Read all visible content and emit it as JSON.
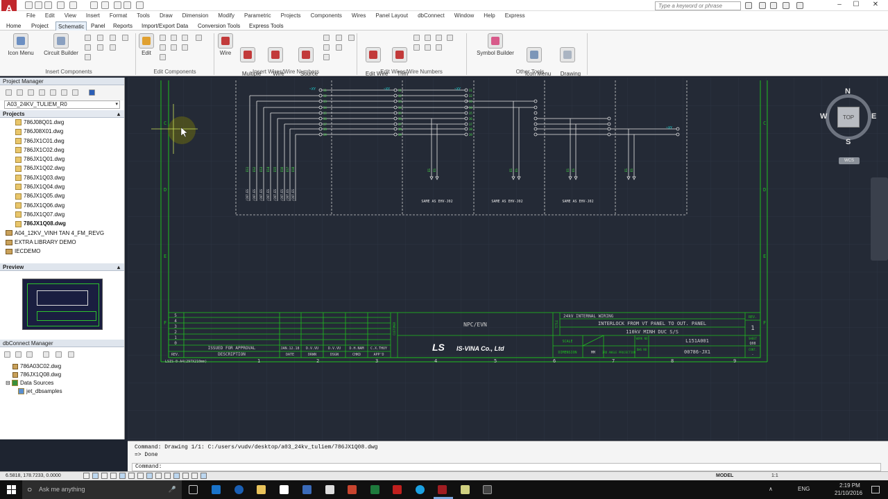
{
  "window": {
    "search_placeholder": "Type a keyword or phrase",
    "min": "–",
    "max": "☐",
    "close": "✕"
  },
  "menubar": [
    "File",
    "Edit",
    "View",
    "Insert",
    "Format",
    "Tools",
    "Draw",
    "Dimension",
    "Modify",
    "Parametric",
    "Projects",
    "Components",
    "Wires",
    "Panel Layout",
    "dbConnect",
    "Window",
    "Help",
    "Express"
  ],
  "tabs": [
    "Home",
    "Project",
    "Schematic",
    "Panel",
    "Reports",
    "Import/Export Data",
    "Conversion Tools",
    "Express Tools"
  ],
  "active_tab": "Schematic",
  "ribbon": {
    "insert_components": {
      "label": "Insert Components",
      "buttons": [
        "Icon Menu",
        "Circuit Builder"
      ]
    },
    "edit_components": {
      "label": "Edit Components",
      "buttons": [
        "Edit"
      ]
    },
    "insert_wires": {
      "label": "Insert Wires/Wire Numbers",
      "buttons": [
        "Wire",
        "Multiple\nBus",
        "Wire\nNumbers",
        "Source\nArrow"
      ]
    },
    "edit_wires": {
      "label": "Edit Wires/Wire Numbers",
      "buttons": [
        "Edit Wire\nNumber",
        "Trim\nWire"
      ]
    },
    "other_tools": {
      "label": "Other Tools",
      "buttons": [
        "Symbol Builder",
        "Icon Menu\nWizard",
        "Drawing\nProperties"
      ]
    }
  },
  "project_manager": {
    "title": "Project Manager",
    "current_project": "A03_24KV_TULIEM_R0",
    "projects_label": "Projects",
    "files": [
      "786J08Q01.dwg",
      "786J08X01.dwg",
      "786JX1C01.dwg",
      "786JX1C02.dwg",
      "786JX1Q01.dwg",
      "786JX1Q02.dwg",
      "786JX1Q03.dwg",
      "786JX1Q04.dwg",
      "786JX1Q05.dwg",
      "786JX1Q06.dwg",
      "786JX1Q07.dwg",
      "786JX1Q08.dwg"
    ],
    "active_file": "786JX1Q08.dwg",
    "other_projects": [
      "A04_12KV_VINH TAN 4_FM_REVG",
      "EXTRA LIBRARY DEMO",
      "IECDEMO"
    ],
    "preview_label": "Preview"
  },
  "dbconnect": {
    "title": "dbConnect Manager",
    "items": [
      "786A03C02.dwg",
      "786JX1Q08.dwg"
    ],
    "data_sources": "Data Sources",
    "source": "jet_dbsamples"
  },
  "drawing": {
    "row_labels": [
      "C",
      "D",
      "E",
      "F"
    ],
    "col_numbers": [
      "1",
      "2",
      "3",
      "4",
      "5",
      "6",
      "7",
      "8",
      "9"
    ],
    "same_as": [
      "SAME AS EHV-J02",
      "SAME AS EHV-J02",
      "SAME AS EHV-J02"
    ],
    "bus_label": "~XY",
    "title_block": {
      "customer": "NPC/EVN",
      "customer_tag": "CUSTOMER",
      "title_tag": "TITLE",
      "title1": "24kV INTERNAL WIRING",
      "title2": "INTERLOCK FROM VT PANEL TO OUT. PANEL",
      "title3": "110kV MINH DUC S/S",
      "rev_tag": "REV.",
      "rev_val": "1",
      "scale_tag": "SCALE",
      "work_no_tag": "WORK NO",
      "work_no": "L151A001",
      "sheet_tag": "SHEET",
      "sheet": "Q08",
      "dimension_tag": "DIMENSION",
      "unit": "MM",
      "projection": "3RD ANGLE PROJECTION",
      "dwg_no_tag": "DWG NO",
      "dwg_no": "00786-JX1",
      "cont_tag": "CONT.",
      "cont": "-",
      "company_logo": "LS",
      "company": "IS-VINA Co., Ltd",
      "rev_rows": [
        "5",
        "4",
        "3",
        "2",
        "1",
        "0"
      ],
      "issued": "ISSUED FOR APPROVAL",
      "issue_date": "JAN.12.18",
      "drawn": "D.V.VU",
      "designed": "D.V.VU",
      "checked": "D.H.NAM",
      "approved": "C.X.THUY",
      "hdr_rev": "REV.",
      "hdr_desc": "DESCRIPTION",
      "hdr_date": "DATE",
      "hdr_drwn": "DRWN",
      "hdr_dsgn": "DSGN",
      "hdr_chkd": "CHKD",
      "hdr_appd": "APP'D"
    },
    "sheet_code": "LSIS-0-A4(297X210mm)"
  },
  "viewcube": {
    "n": "N",
    "s": "S",
    "e": "E",
    "w": "W",
    "top": "TOP",
    "wcs": "WCS"
  },
  "command": {
    "line1": "Command: Drawing 1/1: C:/users/vudv/desktop/a03_24kv_tuliem/786JX1Q08.dwg",
    "line2": "=> Done",
    "prompt": "Command:"
  },
  "status": {
    "coords": "6.5818, 178.7233, 0.0000",
    "model": "MODEL",
    "scale": "1:1"
  },
  "taskbar": {
    "search": "Ask me anything",
    "lang": "ENG",
    "time": "2:19 PM",
    "date": "21/10/2016"
  },
  "colors": {
    "canvas": "#242a36",
    "border_green": "#1fbf1f",
    "wire_white": "#e8e8e8",
    "label_green": "#49e049",
    "cyan": "#1fd0d0"
  }
}
